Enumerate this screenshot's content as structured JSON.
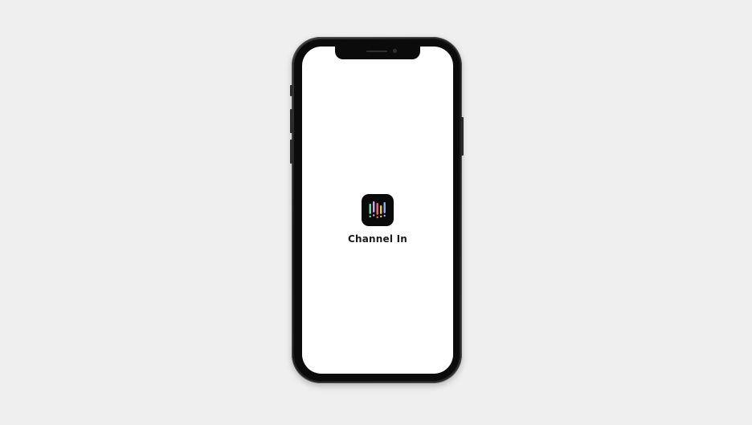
{
  "device": {
    "model": "smartphone",
    "frame_color": "#1a1a1a",
    "screen_color": "#ffffff",
    "background_color": "#efefef"
  },
  "splash": {
    "app_name": "Channel In",
    "icon": {
      "name": "channel-in-app-icon",
      "background": "#0a0a0a",
      "bars": [
        {
          "color": "#7ed6a8"
        },
        {
          "color": "#c9a8f0"
        },
        {
          "color": "#f06a7a"
        },
        {
          "color": "#f4c34d"
        },
        {
          "color": "#8fb0f5"
        }
      ]
    }
  }
}
